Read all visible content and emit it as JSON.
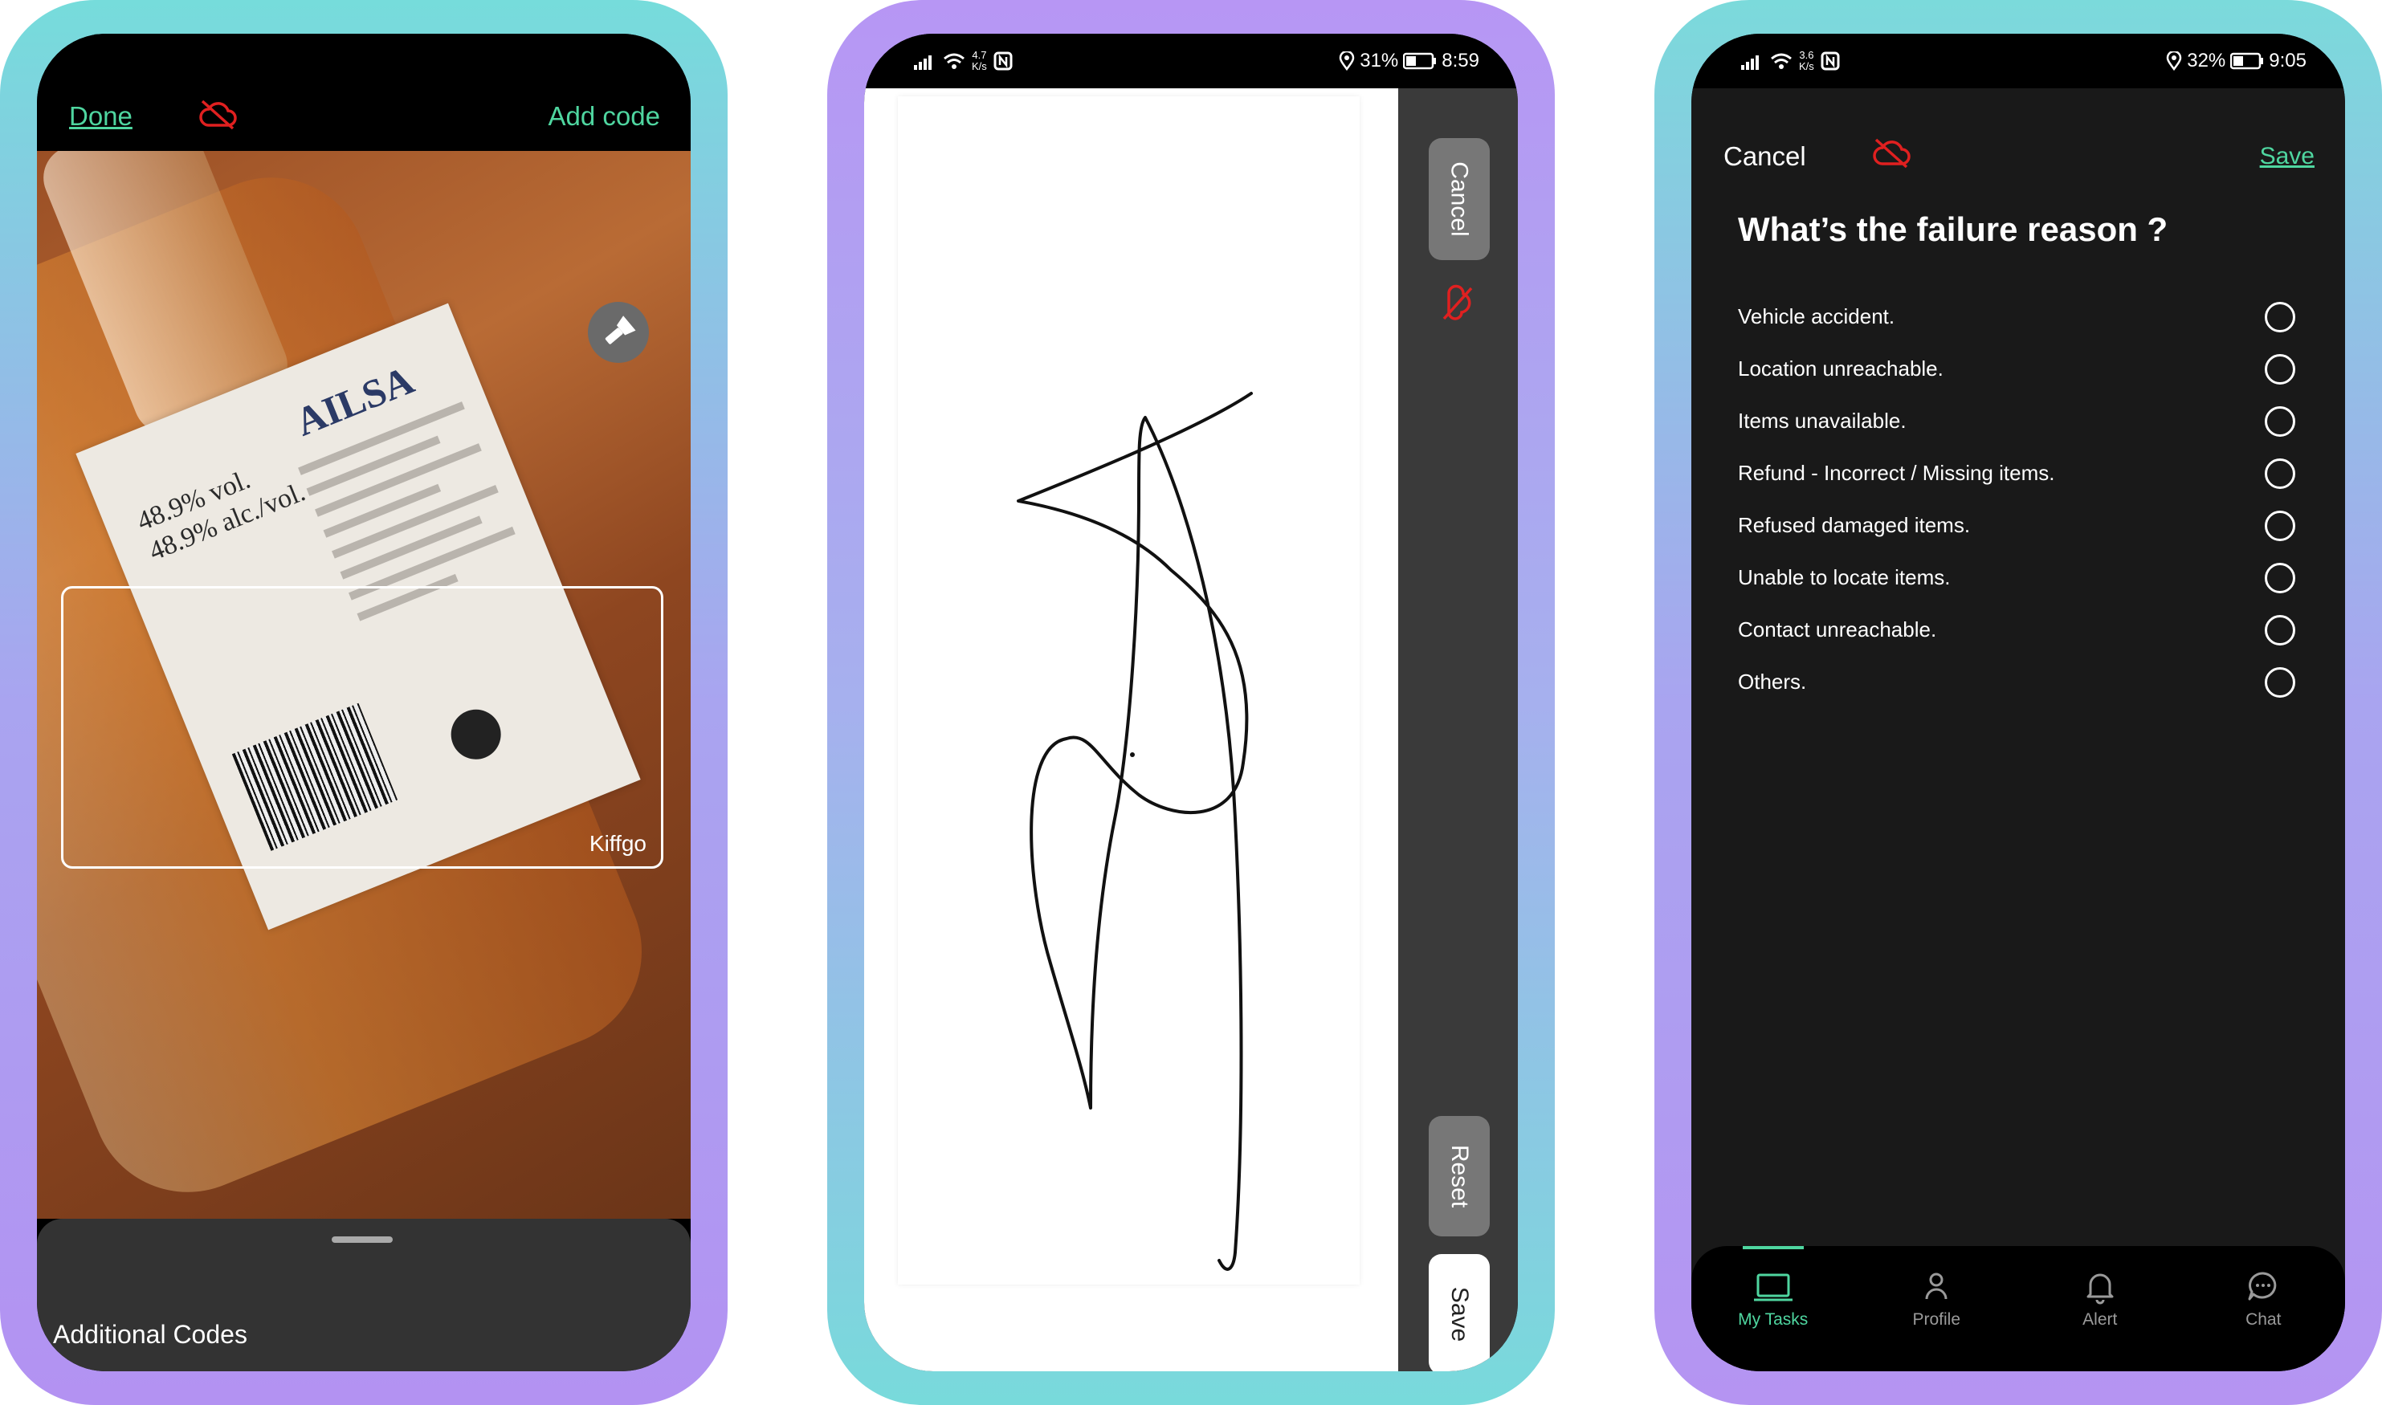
{
  "screens": {
    "scanner": {
      "done_label": "Done",
      "add_code_label": "Add code",
      "scan_box_label": "Kiffgo",
      "sheet_title": "Additional Codes",
      "bottle_brand": "AILSA",
      "bottle_abv": [
        "48.9% vol.",
        "48.9% alc./vol."
      ]
    },
    "signature": {
      "status": {
        "speed_value": "4.7",
        "speed_unit": "K/s",
        "battery": "31%",
        "time": "8:59"
      },
      "cancel_label": "Cancel",
      "reset_label": "Reset",
      "save_label": "Save"
    },
    "failure": {
      "status": {
        "speed_value": "3.6",
        "speed_unit": "K/s",
        "battery": "32%",
        "time": "9:05"
      },
      "cancel_label": "Cancel",
      "save_label": "Save",
      "title": "What’s the failure reason ?",
      "reasons": [
        "Vehicle accident.",
        "Location unreachable.",
        "Items unavailable.",
        "Refund - Incorrect / Missing items.",
        "Refused damaged items.",
        "Unable to locate items.",
        "Contact unreachable.",
        "Others."
      ],
      "nav": [
        {
          "label": "My Tasks",
          "icon": "laptop-icon",
          "active": true
        },
        {
          "label": "Profile",
          "icon": "person-icon",
          "active": false
        },
        {
          "label": "Alert",
          "icon": "bell-icon",
          "active": false
        },
        {
          "label": "Chat",
          "icon": "chat-bubble-icon",
          "active": false
        }
      ]
    }
  },
  "colors": {
    "accent_green": "#4fd6a0",
    "offline_red": "#e02020",
    "dark_bg": "#191919",
    "side_panel": "#3a3a3a"
  }
}
